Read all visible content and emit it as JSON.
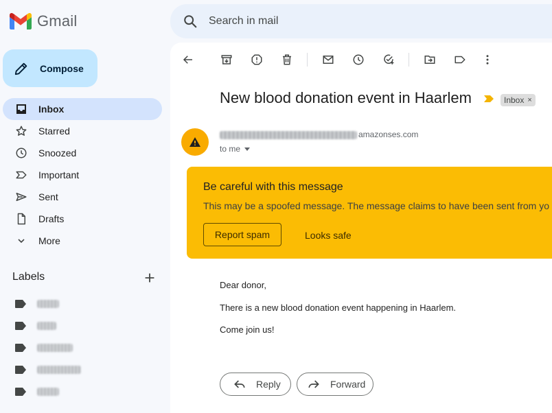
{
  "app": {
    "name": "Gmail"
  },
  "search": {
    "placeholder": "Search in mail"
  },
  "compose": {
    "label": "Compose"
  },
  "nav": [
    {
      "label": "Inbox",
      "icon": "inbox-icon",
      "active": true
    },
    {
      "label": "Starred",
      "icon": "star-icon"
    },
    {
      "label": "Snoozed",
      "icon": "clock-icon"
    },
    {
      "label": "Important",
      "icon": "important-icon"
    },
    {
      "label": "Sent",
      "icon": "send-icon"
    },
    {
      "label": "Drafts",
      "icon": "draft-icon"
    },
    {
      "label": "More",
      "icon": "chevron-down-icon"
    }
  ],
  "labels": {
    "heading": "Labels"
  },
  "email": {
    "subject": "New blood donation event in Haarlem",
    "folder_chip": "Inbox",
    "chip_close": "×",
    "sender_domain": "amazonses.com",
    "recipient": "to me",
    "warning": {
      "title": "Be careful with this message",
      "text": "This may be a spoofed message. The message claims to have been sent from yo",
      "report_spam": "Report spam",
      "looks_safe": "Looks safe"
    },
    "body": [
      "Dear donor,",
      "There is a new blood donation event happening in Haarlem.",
      "Come join us!"
    ],
    "actions": {
      "reply": "Reply",
      "forward": "Forward"
    }
  },
  "colors": {
    "warning_bg": "#fbbc04",
    "avatar_bg": "#f9ab00",
    "compose_bg": "#c2e7ff",
    "active_nav_bg": "#d3e3fd"
  }
}
